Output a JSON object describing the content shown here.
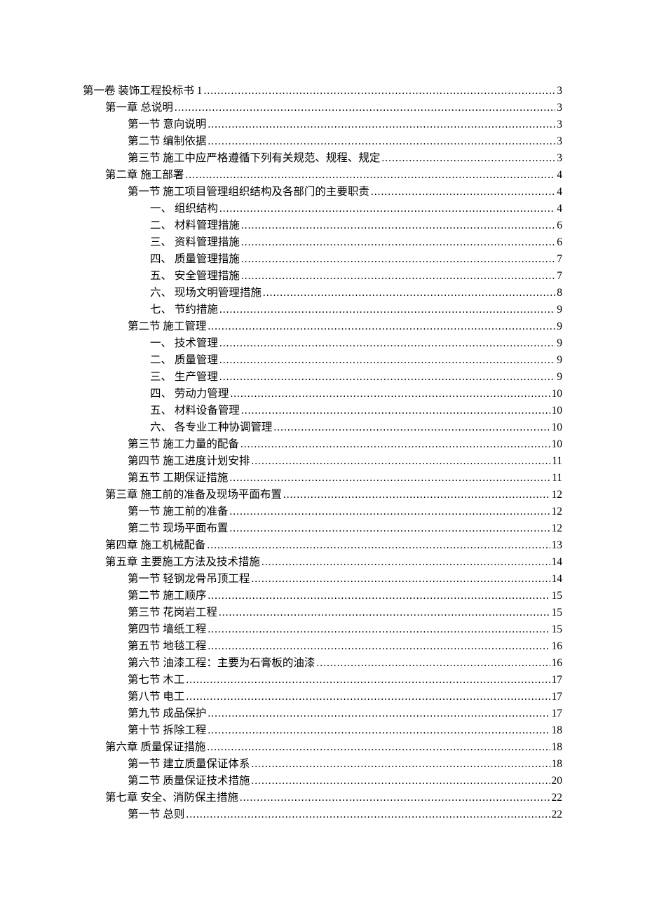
{
  "toc": [
    {
      "level": 0,
      "label": "第一卷  装饰工程投标书 1",
      "page": "3"
    },
    {
      "level": 1,
      "label": "第一章  总说明",
      "page": "3"
    },
    {
      "level": 2,
      "label": "第一节  意向说明",
      "page": "3"
    },
    {
      "level": 2,
      "label": "第二节  编制依据",
      "page": "3"
    },
    {
      "level": 2,
      "label": "第三节  施工中应严格遵循下列有关规范、规程、规定",
      "page": "3"
    },
    {
      "level": 1,
      "label": "第二章  施工部署",
      "page": "4"
    },
    {
      "level": 2,
      "label": "第一节  施工项目管理组织结构及各部门的主要职责",
      "page": "4"
    },
    {
      "level": 3,
      "label": "一、   组织结构",
      "page": "4"
    },
    {
      "level": 3,
      "label": "二、   材料管理措施",
      "page": "6"
    },
    {
      "level": 3,
      "label": "三、   资料管理措施",
      "page": "6"
    },
    {
      "level": 3,
      "label": "四、   质量管理措施",
      "page": "7"
    },
    {
      "level": 3,
      "label": "五、   安全管理措施",
      "page": "7"
    },
    {
      "level": 3,
      "label": "六、   现场文明管理措施",
      "page": "8"
    },
    {
      "level": 3,
      "label": "七、   节约措施",
      "page": "9"
    },
    {
      "level": 2,
      "label": "第二节  施工管理",
      "page": "9"
    },
    {
      "level": 3,
      "label": "一、   技术管理",
      "page": "9"
    },
    {
      "level": 3,
      "label": "二、   质量管理",
      "page": "9"
    },
    {
      "level": 3,
      "label": "三、   生产管理",
      "page": "9"
    },
    {
      "level": 3,
      "label": "四、   劳动力管理",
      "page": "10"
    },
    {
      "level": 3,
      "label": "五、   材料设备管理",
      "page": "10"
    },
    {
      "level": 3,
      "label": "六、   各专业工种协调管理",
      "page": "10"
    },
    {
      "level": 2,
      "label": "第三节  施工力量的配备",
      "page": "10"
    },
    {
      "level": 2,
      "label": "第四节  施工进度计划安排",
      "page": "11"
    },
    {
      "level": 2,
      "label": "第五节  工期保证措施",
      "page": "11"
    },
    {
      "level": 1,
      "label": "第三章  施工前的准备及现场平面布置",
      "page": "12"
    },
    {
      "level": 2,
      "label": "第一节  施工前的准备",
      "page": "12"
    },
    {
      "level": 2,
      "label": "第二节  现场平面布置",
      "page": "12"
    },
    {
      "level": 1,
      "label": "第四章  施工机械配备",
      "page": "13"
    },
    {
      "level": 1,
      "label": "第五章  主要施工方法及技术措施",
      "page": "14"
    },
    {
      "level": 2,
      "label": "第一节  轻钢龙骨吊顶工程",
      "page": "14"
    },
    {
      "level": 2,
      "label": "第二节  施工顺序",
      "page": "15"
    },
    {
      "level": 2,
      "label": "第三节  花岗岩工程",
      "page": "15"
    },
    {
      "level": 2,
      "label": "第四节  墙纸工程",
      "page": "15"
    },
    {
      "level": 2,
      "label": "第五节  地毯工程",
      "page": "16"
    },
    {
      "level": 2,
      "label": "第六节  油漆工程：主要为石膏板的油漆",
      "page": "16"
    },
    {
      "level": 2,
      "label": "第七节  木工",
      "page": "17"
    },
    {
      "level": 2,
      "label": "第八节  电工",
      "page": "17"
    },
    {
      "level": 2,
      "label": "第九节  成品保护",
      "page": "17"
    },
    {
      "level": 2,
      "label": "第十节  拆除工程",
      "page": "18"
    },
    {
      "level": 1,
      "label": "第六章  质量保证措施",
      "page": "18"
    },
    {
      "level": 2,
      "label": "第一节  建立质量保证体系",
      "page": "18"
    },
    {
      "level": 2,
      "label": "第二节  质量保证技术措施",
      "page": "20"
    },
    {
      "level": 1,
      "label": "第七章  安全、消防保主措施",
      "page": "22"
    },
    {
      "level": 2,
      "label": "第一节  总则",
      "page": "22"
    }
  ]
}
